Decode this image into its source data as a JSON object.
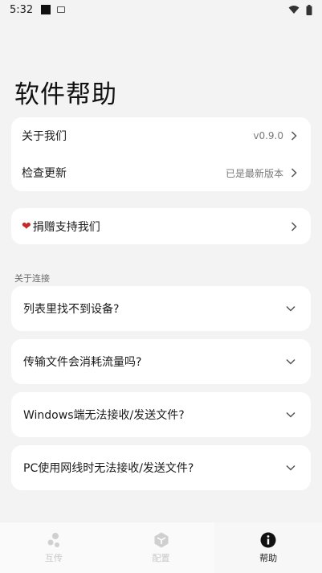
{
  "status_bar": {
    "time": "5:32"
  },
  "page": {
    "title": "软件帮助"
  },
  "about_card": {
    "about_us": {
      "label": "关于我们",
      "value": "v0.9.0"
    },
    "check_update": {
      "label": "检查更新",
      "value": "已是最新版本"
    }
  },
  "donate": {
    "label": "捐赠支持我们",
    "icon": "heart-icon"
  },
  "section": {
    "label": "关于连接"
  },
  "faq": [
    {
      "label": "列表里找不到设备?"
    },
    {
      "label": "传输文件会消耗流量吗?"
    },
    {
      "label": "Windows端无法接收/发送文件?"
    },
    {
      "label": "PC使用网线时无法接收/发送文件?"
    }
  ],
  "bottom_nav": [
    {
      "label": "互传",
      "icon": "transfer-icon",
      "active": false
    },
    {
      "label": "配置",
      "icon": "settings-cube-icon",
      "active": false
    },
    {
      "label": "帮助",
      "icon": "info-icon",
      "active": true
    }
  ],
  "colors": {
    "background": "#f3f3f3",
    "card": "#ffffff",
    "heart": "#c62828"
  }
}
